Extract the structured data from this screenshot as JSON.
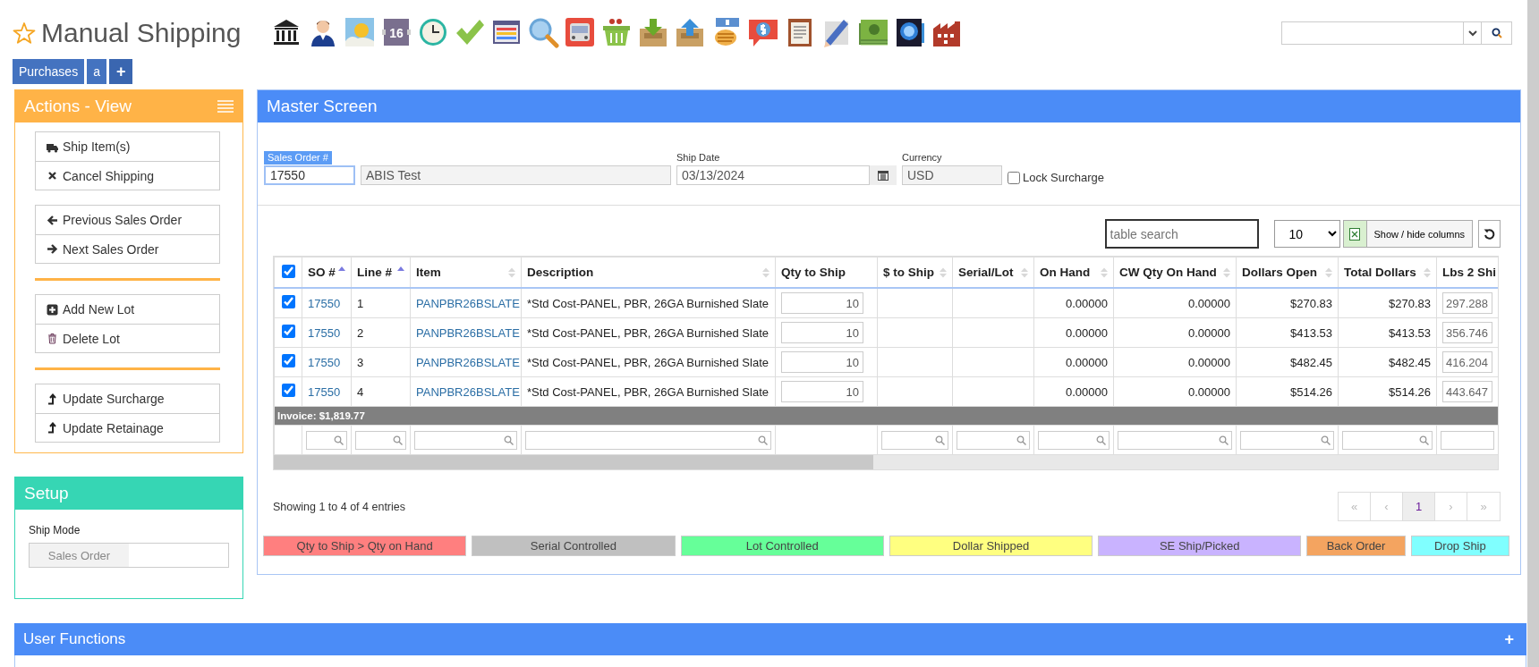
{
  "header": {
    "title": "Manual Shipping"
  },
  "toolbar": [
    {
      "kind": "bank"
    },
    {
      "kind": "person"
    },
    {
      "kind": "weather"
    },
    {
      "kind": "calendar",
      "text": "16"
    },
    {
      "kind": "clock"
    },
    {
      "kind": "check"
    },
    {
      "kind": "window"
    },
    {
      "kind": "magnifier"
    },
    {
      "kind": "bus"
    },
    {
      "kind": "basket"
    },
    {
      "kind": "tray-down"
    },
    {
      "kind": "tray-up"
    },
    {
      "kind": "hand-coins"
    },
    {
      "kind": "speech-dollar"
    },
    {
      "kind": "clipboard"
    },
    {
      "kind": "pencil"
    },
    {
      "kind": "cash"
    },
    {
      "kind": "gauge"
    },
    {
      "kind": "factory"
    }
  ],
  "tabs": [
    {
      "label": "Purchases"
    },
    {
      "label": "a"
    },
    {
      "label": "+"
    }
  ],
  "actions": {
    "title": "Actions - View",
    "groups": [
      {
        "divider": false,
        "items": [
          {
            "label": "Ship Item(s)",
            "kind": "truck"
          },
          {
            "label": "Cancel Shipping",
            "kind": "times"
          }
        ]
      },
      {
        "divider": false,
        "items": [
          {
            "label": "Previous Sales Order",
            "kind": "arrow-left"
          },
          {
            "label": "Next Sales Order",
            "kind": "arrow-right"
          }
        ]
      },
      {
        "divider": true,
        "items": [
          {
            "label": "Add New Lot",
            "kind": "plus-square"
          },
          {
            "label": "Delete Lot",
            "kind": "trash"
          }
        ]
      },
      {
        "divider": true,
        "items": [
          {
            "label": "Update Surcharge",
            "kind": "level-up"
          },
          {
            "label": "Update Retainage",
            "kind": "level-up"
          }
        ]
      }
    ]
  },
  "setup": {
    "title": "Setup",
    "ship_mode": {
      "label": "Ship Mode",
      "value": "Sales Order"
    }
  },
  "master": {
    "title": "Master Screen",
    "sales_order": {
      "label": "Sales Order #",
      "value": "17550"
    },
    "customer": {
      "value": "ABIS Test"
    },
    "ship_date": {
      "label": "Ship Date",
      "value": "03/13/2024"
    },
    "currency": {
      "label": "Currency",
      "value": "USD"
    },
    "lock_surcharge": {
      "label": "Lock Surcharge",
      "checked": false
    },
    "table_search": {
      "placeholder": "table search"
    },
    "page_length": "10",
    "colvis": "Show / hide columns",
    "all_selected": true,
    "columns": [
      {
        "label": "SO #",
        "kind": "link",
        "sortable": true,
        "sorted": true,
        "filter": true
      },
      {
        "label": "Line #",
        "kind": "text",
        "sortable": true,
        "sorted": true,
        "filter": true
      },
      {
        "label": "Item",
        "kind": "link",
        "sortable": true,
        "sorted": false,
        "filter": true
      },
      {
        "label": "Description",
        "kind": "text",
        "sortable": true,
        "sorted": false,
        "filter": true
      },
      {
        "label": "Qty to Ship",
        "kind": "input",
        "sortable": false,
        "filter": false
      },
      {
        "label": "$ to Ship",
        "kind": "num",
        "sortable": true,
        "sorted": false,
        "filter": true
      },
      {
        "label": "Serial/Lot",
        "kind": "text",
        "sortable": true,
        "sorted": false,
        "filter": true
      },
      {
        "label": "On Hand",
        "kind": "num",
        "sortable": true,
        "sorted": false,
        "filter": true
      },
      {
        "label": "CW Qty On Hand",
        "kind": "num",
        "sortable": true,
        "sorted": false,
        "filter": true
      },
      {
        "label": "Dollars Open",
        "kind": "num",
        "sortable": true,
        "sorted": false,
        "filter": true
      },
      {
        "label": "Total Dollars",
        "kind": "num",
        "sortable": true,
        "sorted": false,
        "filter": true
      },
      {
        "label": "Lbs 2 Shi",
        "kind": "input",
        "sortable": false,
        "filter": true
      }
    ],
    "rows": [
      {
        "selected": true,
        "cells": [
          "17550",
          "1",
          "PANPBR26BSLATE",
          "*Std Cost-PANEL, PBR, 26GA Burnished Slate",
          "10",
          null,
          null,
          "0.00000",
          "0.00000",
          "$270.83",
          "$270.83",
          "297.288"
        ]
      },
      {
        "selected": true,
        "cells": [
          "17550",
          "2",
          "PANPBR26BSLATE",
          "*Std Cost-PANEL, PBR, 26GA Burnished Slate",
          "10",
          null,
          null,
          "0.00000",
          "0.00000",
          "$413.53",
          "$413.53",
          "356.746"
        ]
      },
      {
        "selected": true,
        "cells": [
          "17550",
          "3",
          "PANPBR26BSLATE",
          "*Std Cost-PANEL, PBR, 26GA Burnished Slate",
          "10",
          null,
          null,
          "0.00000",
          "0.00000",
          "$482.45",
          "$482.45",
          "416.204"
        ]
      },
      {
        "selected": true,
        "cells": [
          "17550",
          "4",
          "PANPBR26BSLATE",
          "*Std Cost-PANEL, PBR, 26GA Burnished Slate",
          "10",
          null,
          null,
          "0.00000",
          "0.00000",
          "$514.26",
          "$514.26",
          "443.647"
        ]
      }
    ],
    "invoice": "Invoice: $1,819.77",
    "info": "Showing 1 to 4 of 4 entries",
    "pagination": [
      {
        "label": "«",
        "selected": false,
        "disabled": true
      },
      {
        "label": "‹",
        "selected": false,
        "disabled": true
      },
      {
        "label": "1",
        "selected": true,
        "disabled": false
      },
      {
        "label": "›",
        "selected": false,
        "disabled": true
      },
      {
        "label": "»",
        "selected": false,
        "disabled": true
      }
    ],
    "legend": [
      {
        "label": "Qty to Ship > Qty on Hand",
        "color": "#ff7f7f"
      },
      {
        "label": "Serial Controlled",
        "color": "#c0c0c0"
      },
      {
        "label": "Lot Controlled",
        "color": "#66ff99"
      },
      {
        "label": "Dollar Shipped",
        "color": "#ffff80"
      },
      {
        "label": "SE Ship/Picked",
        "color": "#c9b3ff"
      },
      {
        "label": "Back Order",
        "color": "#f4a460"
      },
      {
        "label": "Drop Ship",
        "color": "#80ffff"
      }
    ]
  },
  "user_functions": {
    "title": "User Functions",
    "toggle": "+"
  }
}
